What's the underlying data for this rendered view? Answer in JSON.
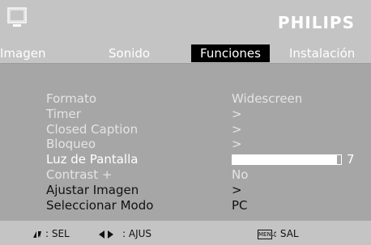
{
  "brand": "PHILIPS",
  "icons": {
    "tv": "tv-icon",
    "updown": "up-down-arrows-icon",
    "leftright": "left-right-arrows-icon"
  },
  "tabs": [
    {
      "label": "Imagen",
      "active": false
    },
    {
      "label": "Sonido",
      "active": false
    },
    {
      "label": "Funciones",
      "active": true
    },
    {
      "label": "Instalación",
      "active": false
    }
  ],
  "menu": [
    {
      "label": "Formato",
      "value": "Widescreen"
    },
    {
      "label": "Timer",
      "value": ">"
    },
    {
      "label": "Closed Caption",
      "value": ">"
    },
    {
      "label": "Bloqueo",
      "value": ">"
    },
    {
      "label": "Luz de Pantalla",
      "level": 7,
      "level_fraction": 0.96
    },
    {
      "label": "Contrast +",
      "value": "No"
    },
    {
      "label": "Ajustar Imagen",
      "value": ">"
    },
    {
      "label": "Seleccionar Modo",
      "value": "PC"
    }
  ],
  "footer": {
    "sel": ": SEL",
    "ajus": ": AJUS",
    "menu_key": "MENU",
    "sal": ": SAL"
  },
  "colors": {
    "panel_bg": "#a6a6a6",
    "header_bg": "#c4c4c4",
    "active_tab_bg": "#000000",
    "text_light": "#e4e4e4",
    "text_active": "#ffffff",
    "text_dark": "#111111"
  }
}
